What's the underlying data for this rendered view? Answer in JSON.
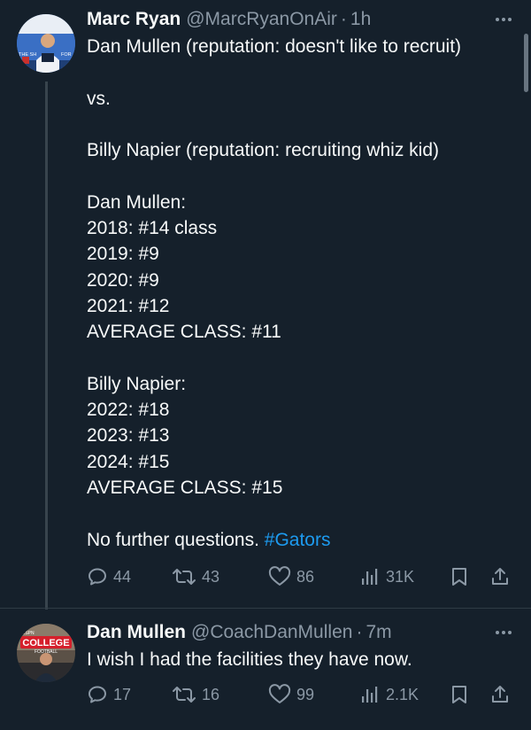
{
  "colors": {
    "background": "#15202b",
    "text": "#f7f9f9",
    "secondary_text": "#8b98a5",
    "link": "#1d9bf0",
    "thread_line": "#38444d"
  },
  "tweets": [
    {
      "avatar": {
        "icon": "avatar-press-conference",
        "text_banner": "THE SH",
        "text_side": "FOR"
      },
      "name": "Marc Ryan",
      "handle": "@MarcRyanOnAir",
      "separator": "·",
      "time": "1h",
      "text": "Dan Mullen (reputation: doesn't like to recruit)\n\nvs.\n\nBilly Napier (reputation: recruiting whiz kid)\n\nDan Mullen:\n2018: #14 class\n2019: #9\n2020: #9\n2021: #12\nAVERAGE CLASS: #11\n\nBilly Napier:\n2022: #18\n2023: #13\n2024: #15\nAVERAGE CLASS: #15\n\nNo further questions. ",
      "hashtag": "#Gators",
      "actions": {
        "replies": "44",
        "retweets": "43",
        "likes": "86",
        "views": "31K"
      }
    },
    {
      "avatar": {
        "icon": "avatar-college-football",
        "banner": "COLLEGE",
        "sub": "FOOTBALL",
        "espn": "ESPN"
      },
      "name": "Dan Mullen",
      "handle": "@CoachDanMullen",
      "separator": "·",
      "time": "7m",
      "text": "I wish I had the facilities they have now.",
      "actions": {
        "replies": "17",
        "retweets": "16",
        "likes": "99",
        "views": "2.1K"
      }
    }
  ]
}
